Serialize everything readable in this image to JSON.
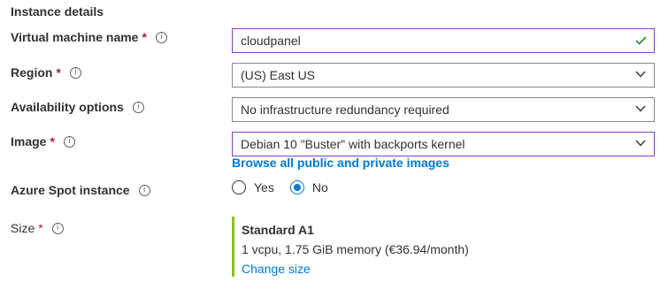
{
  "section": {
    "title": "Instance details"
  },
  "vm_name": {
    "label": "Virtual machine name",
    "required_mark": "*",
    "value": "cloudpanel"
  },
  "region": {
    "label": "Region",
    "required_mark": "*",
    "value": "(US) East US"
  },
  "availability": {
    "label": "Availability options",
    "value": "No infrastructure redundancy required"
  },
  "image": {
    "label": "Image",
    "required_mark": "*",
    "value": "Debian 10 \"Buster\" with backports kernel",
    "browse_link": "Browse all public and private images"
  },
  "spot": {
    "label": "Azure Spot instance",
    "options": [
      "Yes",
      "No"
    ],
    "selected": "No"
  },
  "size": {
    "label": "Size",
    "required_mark": "*",
    "name": "Standard A1",
    "description": "1 vcpu, 1.75 GiB memory (€36.94/month)",
    "change_link": "Change size"
  },
  "icons": {
    "info": "info-icon",
    "chevron": "chevron-down-icon",
    "check": "checkmark-icon"
  },
  "colors": {
    "accent": "#0078d4",
    "required": "#a4262c",
    "valid": "#107c10",
    "focus_border": "#8a3dc4",
    "size_bar": "#8cbd18"
  }
}
